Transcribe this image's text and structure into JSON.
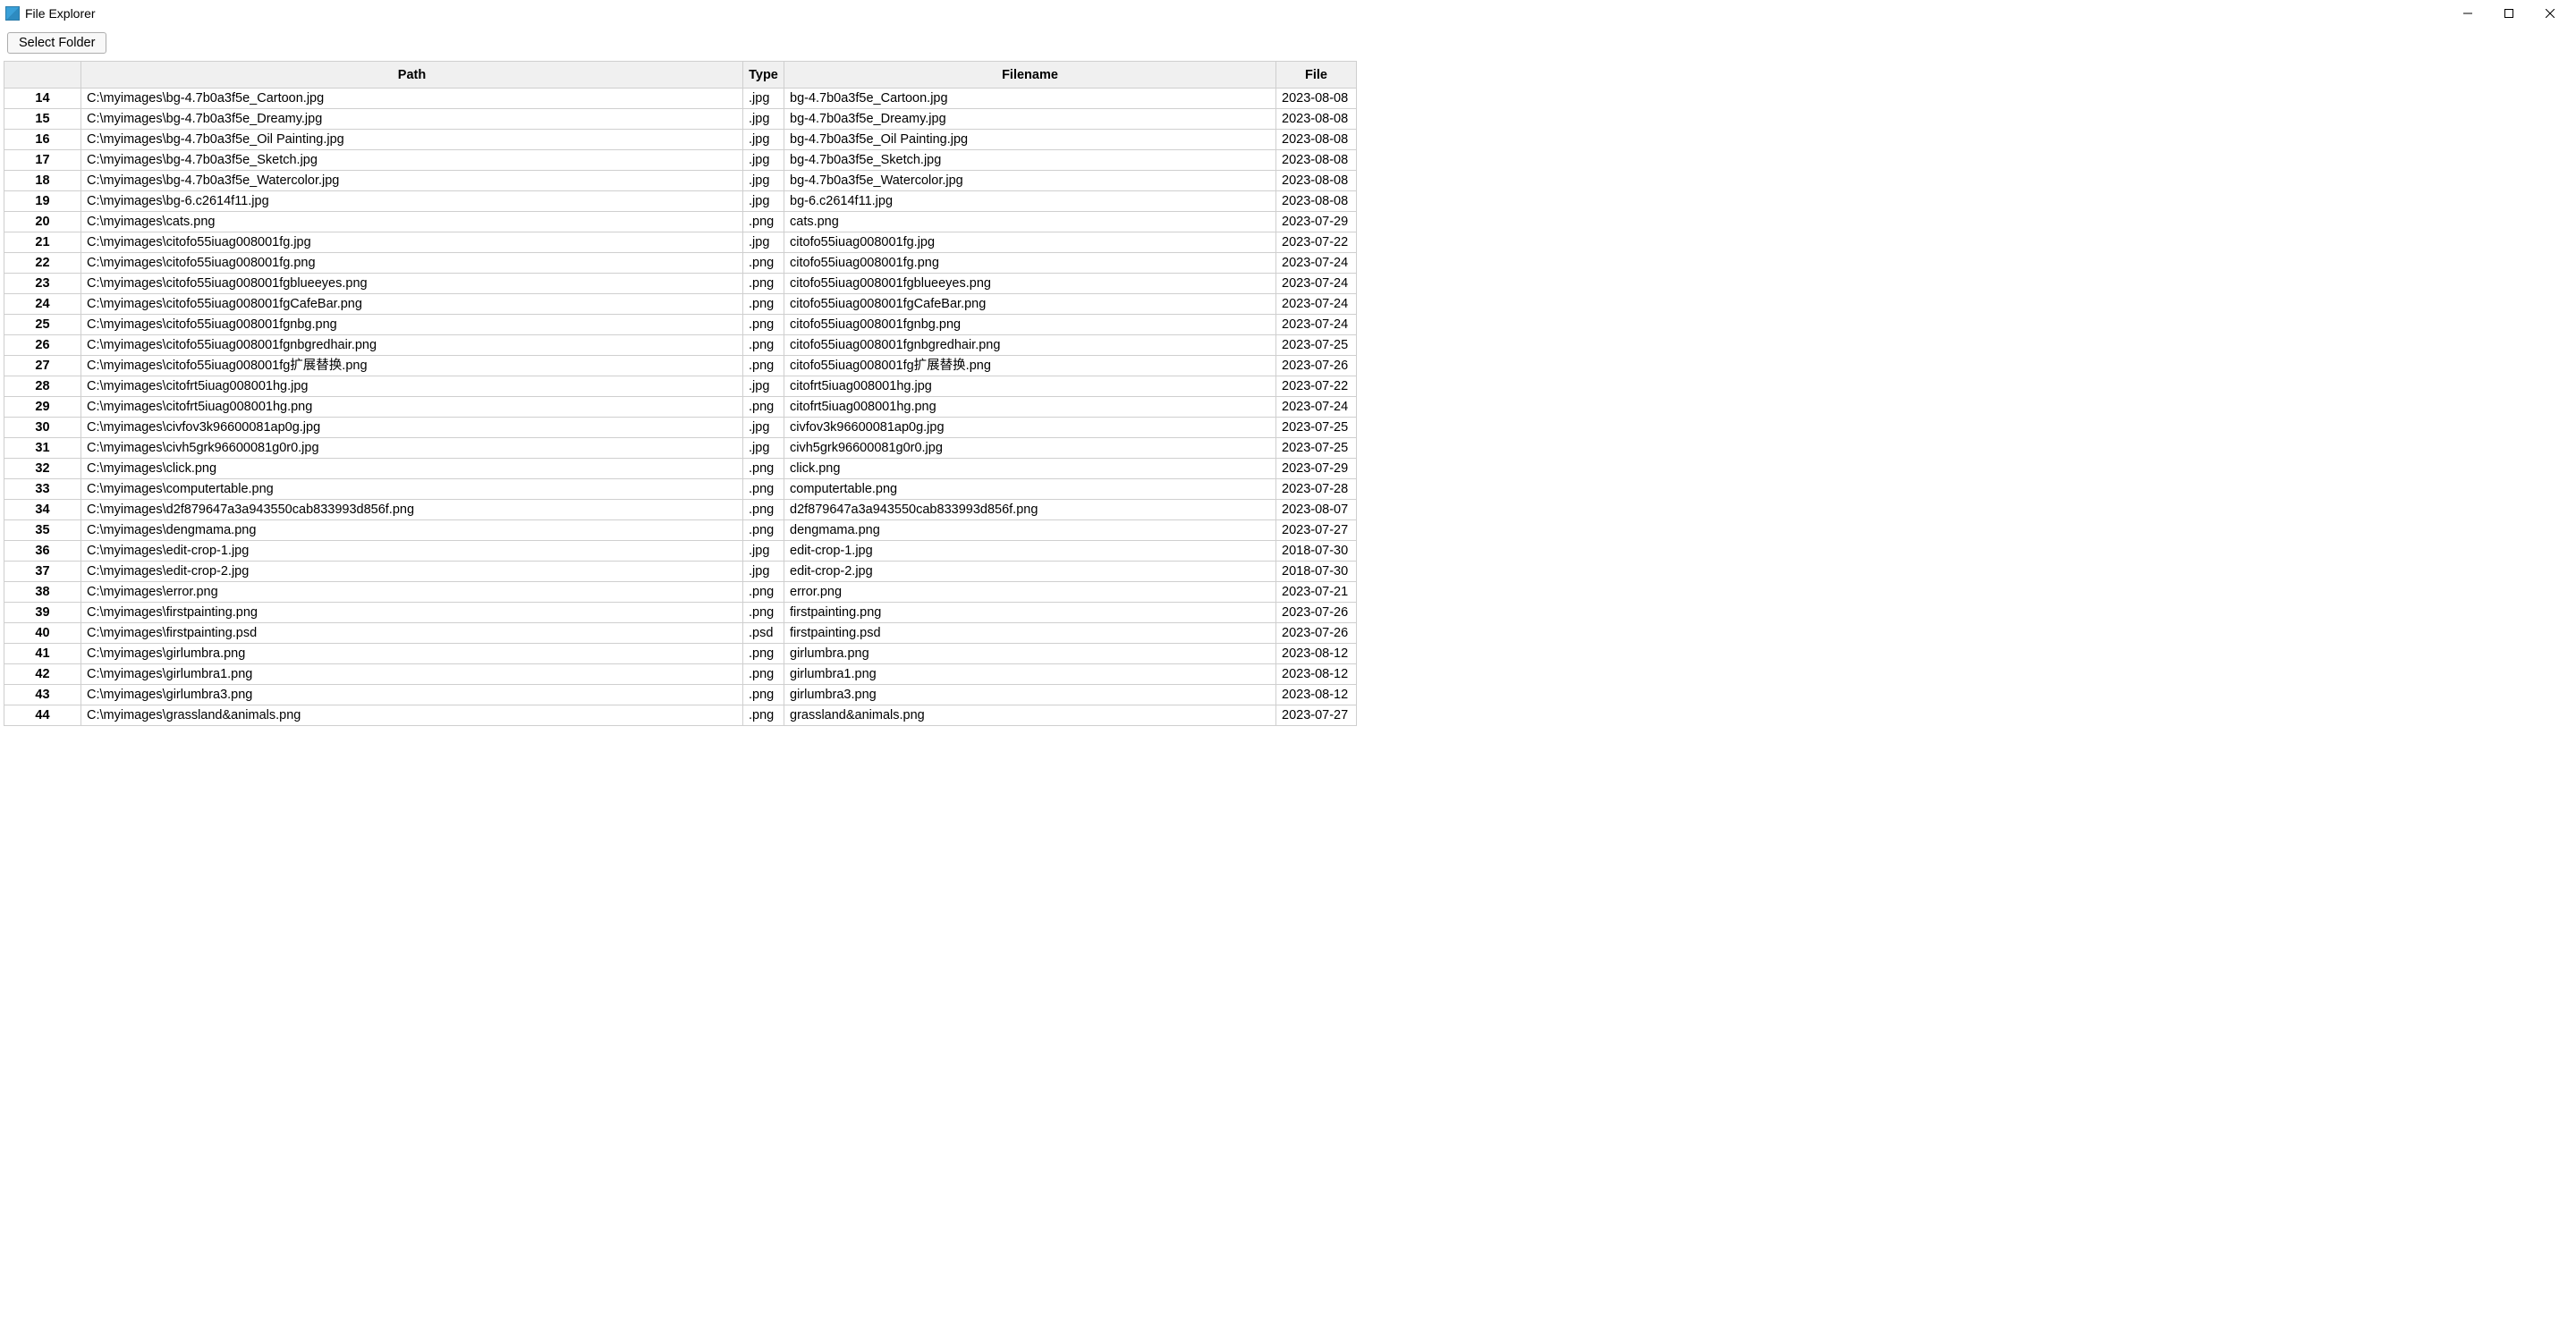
{
  "window": {
    "title": "File Explorer"
  },
  "toolbar": {
    "select_folder_label": "Select Folder"
  },
  "columns": {
    "rownum": "",
    "path": "Path",
    "type": "Type",
    "filename": "Filename",
    "date_partial": "File"
  },
  "rows": [
    {
      "n": "14",
      "path": "C:\\myimages\\bg-4.7b0a3f5e_Cartoon.jpg",
      "type": ".jpg",
      "fname": "bg-4.7b0a3f5e_Cartoon.jpg",
      "date": "2023-08-08"
    },
    {
      "n": "15",
      "path": "C:\\myimages\\bg-4.7b0a3f5e_Dreamy.jpg",
      "type": ".jpg",
      "fname": "bg-4.7b0a3f5e_Dreamy.jpg",
      "date": "2023-08-08"
    },
    {
      "n": "16",
      "path": "C:\\myimages\\bg-4.7b0a3f5e_Oil Painting.jpg",
      "type": ".jpg",
      "fname": "bg-4.7b0a3f5e_Oil Painting.jpg",
      "date": "2023-08-08"
    },
    {
      "n": "17",
      "path": "C:\\myimages\\bg-4.7b0a3f5e_Sketch.jpg",
      "type": ".jpg",
      "fname": "bg-4.7b0a3f5e_Sketch.jpg",
      "date": "2023-08-08"
    },
    {
      "n": "18",
      "path": "C:\\myimages\\bg-4.7b0a3f5e_Watercolor.jpg",
      "type": ".jpg",
      "fname": "bg-4.7b0a3f5e_Watercolor.jpg",
      "date": "2023-08-08"
    },
    {
      "n": "19",
      "path": "C:\\myimages\\bg-6.c2614f11.jpg",
      "type": ".jpg",
      "fname": "bg-6.c2614f11.jpg",
      "date": "2023-08-08"
    },
    {
      "n": "20",
      "path": "C:\\myimages\\cats.png",
      "type": ".png",
      "fname": "cats.png",
      "date": "2023-07-29"
    },
    {
      "n": "21",
      "path": "C:\\myimages\\citofo55iuag008001fg.jpg",
      "type": ".jpg",
      "fname": "citofo55iuag008001fg.jpg",
      "date": "2023-07-22"
    },
    {
      "n": "22",
      "path": "C:\\myimages\\citofo55iuag008001fg.png",
      "type": ".png",
      "fname": "citofo55iuag008001fg.png",
      "date": "2023-07-24"
    },
    {
      "n": "23",
      "path": "C:\\myimages\\citofo55iuag008001fgblueeyes.png",
      "type": ".png",
      "fname": "citofo55iuag008001fgblueeyes.png",
      "date": "2023-07-24"
    },
    {
      "n": "24",
      "path": "C:\\myimages\\citofo55iuag008001fgCafeBar.png",
      "type": ".png",
      "fname": "citofo55iuag008001fgCafeBar.png",
      "date": "2023-07-24"
    },
    {
      "n": "25",
      "path": "C:\\myimages\\citofo55iuag008001fgnbg.png",
      "type": ".png",
      "fname": "citofo55iuag008001fgnbg.png",
      "date": "2023-07-24"
    },
    {
      "n": "26",
      "path": "C:\\myimages\\citofo55iuag008001fgnbgredhair.png",
      "type": ".png",
      "fname": "citofo55iuag008001fgnbgredhair.png",
      "date": "2023-07-25"
    },
    {
      "n": "27",
      "path": "C:\\myimages\\citofo55iuag008001fg扩展替换.png",
      "type": ".png",
      "fname": "citofo55iuag008001fg扩展替换.png",
      "date": "2023-07-26"
    },
    {
      "n": "28",
      "path": "C:\\myimages\\citofrt5iuag008001hg.jpg",
      "type": ".jpg",
      "fname": "citofrt5iuag008001hg.jpg",
      "date": "2023-07-22"
    },
    {
      "n": "29",
      "path": "C:\\myimages\\citofrt5iuag008001hg.png",
      "type": ".png",
      "fname": "citofrt5iuag008001hg.png",
      "date": "2023-07-24"
    },
    {
      "n": "30",
      "path": "C:\\myimages\\civfov3k96600081ap0g.jpg",
      "type": ".jpg",
      "fname": "civfov3k96600081ap0g.jpg",
      "date": "2023-07-25"
    },
    {
      "n": "31",
      "path": "C:\\myimages\\civh5grk96600081g0r0.jpg",
      "type": ".jpg",
      "fname": "civh5grk96600081g0r0.jpg",
      "date": "2023-07-25"
    },
    {
      "n": "32",
      "path": "C:\\myimages\\click.png",
      "type": ".png",
      "fname": "click.png",
      "date": "2023-07-29"
    },
    {
      "n": "33",
      "path": "C:\\myimages\\computertable.png",
      "type": ".png",
      "fname": "computertable.png",
      "date": "2023-07-28"
    },
    {
      "n": "34",
      "path": "C:\\myimages\\d2f879647a3a943550cab833993d856f.png",
      "type": ".png",
      "fname": "d2f879647a3a943550cab833993d856f.png",
      "date": "2023-08-07"
    },
    {
      "n": "35",
      "path": "C:\\myimages\\dengmama.png",
      "type": ".png",
      "fname": "dengmama.png",
      "date": "2023-07-27"
    },
    {
      "n": "36",
      "path": "C:\\myimages\\edit-crop-1.jpg",
      "type": ".jpg",
      "fname": "edit-crop-1.jpg",
      "date": "2018-07-30"
    },
    {
      "n": "37",
      "path": "C:\\myimages\\edit-crop-2.jpg",
      "type": ".jpg",
      "fname": "edit-crop-2.jpg",
      "date": "2018-07-30"
    },
    {
      "n": "38",
      "path": "C:\\myimages\\error.png",
      "type": ".png",
      "fname": "error.png",
      "date": "2023-07-21"
    },
    {
      "n": "39",
      "path": "C:\\myimages\\firstpainting.png",
      "type": ".png",
      "fname": "firstpainting.png",
      "date": "2023-07-26"
    },
    {
      "n": "40",
      "path": "C:\\myimages\\firstpainting.psd",
      "type": ".psd",
      "fname": "firstpainting.psd",
      "date": "2023-07-26"
    },
    {
      "n": "41",
      "path": "C:\\myimages\\girlumbra.png",
      "type": ".png",
      "fname": "girlumbra.png",
      "date": "2023-08-12"
    },
    {
      "n": "42",
      "path": "C:\\myimages\\girlumbra1.png",
      "type": ".png",
      "fname": "girlumbra1.png",
      "date": "2023-08-12"
    },
    {
      "n": "43",
      "path": "C:\\myimages\\girlumbra3.png",
      "type": ".png",
      "fname": "girlumbra3.png",
      "date": "2023-08-12"
    },
    {
      "n": "44",
      "path": "C:\\myimages\\grassland&animals.png",
      "type": ".png",
      "fname": "grassland&animals.png",
      "date": "2023-07-27"
    }
  ]
}
